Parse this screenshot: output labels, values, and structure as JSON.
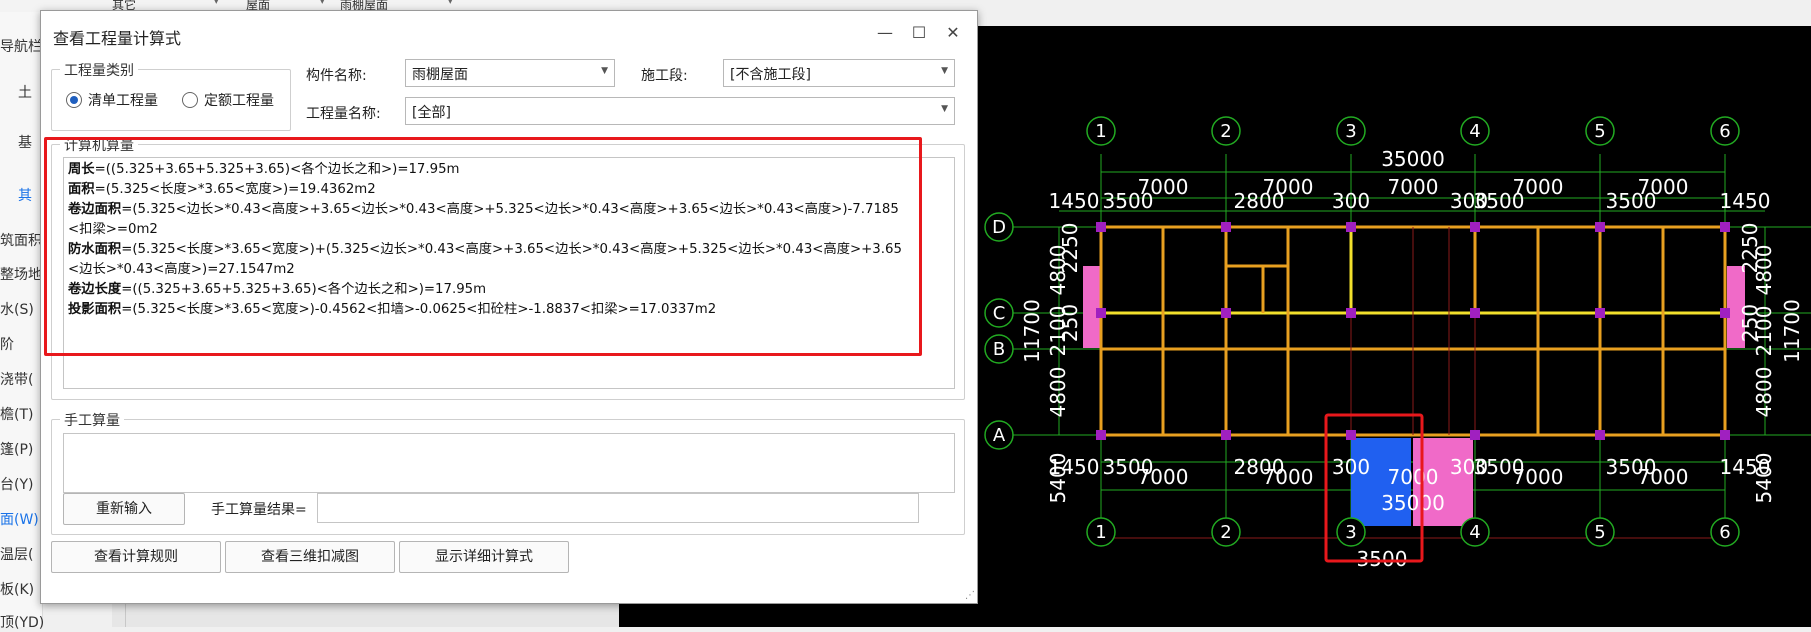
{
  "background": {
    "topbar": [
      "其它",
      "屋面",
      "雨棚屋面"
    ],
    "nav_items": [
      {
        "label": "导航栏",
        "active": false
      },
      {
        "label": "土",
        "active": false
      },
      {
        "label": "基",
        "active": false
      },
      {
        "label": "其",
        "active": true
      },
      {
        "label": "筑面积",
        "active": false
      },
      {
        "label": "整场地",
        "active": false
      },
      {
        "label": "水(S)",
        "active": false
      },
      {
        "label": "阶",
        "active": false
      },
      {
        "label": "浇带(",
        "active": false
      },
      {
        "label": "檐(T)",
        "active": false
      },
      {
        "label": "篷(P)",
        "active": false
      },
      {
        "label": "台(Y)",
        "active": false
      },
      {
        "label": "面(W)",
        "active": true
      },
      {
        "label": "温层(",
        "active": false
      },
      {
        "label": "板(K)",
        "active": false
      },
      {
        "label": "顶(YD)",
        "active": false
      }
    ]
  },
  "dialog": {
    "title": "查看工程量计算式",
    "quantity_type": {
      "group_label": "工程量类别",
      "options": [
        "清单工程量",
        "定额工程量"
      ],
      "selected": "清单工程量"
    },
    "component_name_label": "构件名称:",
    "component_name_value": "雨棚屋面",
    "stage_label": "施工段:",
    "stage_value": "[不含施工段]",
    "quantity_name_label": "工程量名称:",
    "quantity_name_value": "[全部]",
    "computer_calc": {
      "group_label": "计算机算量",
      "lines": [
        {
          "bold": "周长",
          "rest": "=((5.325+3.65+5.325+3.65)<各个边长之和>)=17.95m"
        },
        {
          "bold": "面积",
          "rest": "=(5.325<长度>*3.65<宽度>)=19.4362m2"
        },
        {
          "bold": "卷边面积",
          "rest": "=(5.325<边长>*0.43<高度>+3.65<边长>*0.43<高度>+5.325<边长>*0.43<高度>+3.65<边长>*0.43<高度>)-7.7185"
        },
        {
          "bold": "",
          "rest": "<扣梁>=0m2"
        },
        {
          "bold": "防水面积",
          "rest": "=(5.325<长度>*3.65<宽度>)+(5.325<边长>*0.43<高度>+3.65<边长>*0.43<高度>+5.325<边长>*0.43<高度>+3.65"
        },
        {
          "bold": "",
          "rest": "<边长>*0.43<高度>)=27.1547m2"
        },
        {
          "bold": "卷边长度",
          "rest": "=((5.325+3.65+5.325+3.65)<各个边长之和>)=17.95m"
        },
        {
          "bold": "投影面积",
          "rest": "=(5.325<长度>*3.65<宽度>)-0.4562<扣墙>-0.0625<扣砼柱>-1.8837<扣梁>=17.0337m2"
        }
      ]
    },
    "manual_calc": {
      "group_label": "手工算量",
      "reenter_button": "重新输入",
      "result_label": "手工算量结果="
    },
    "footer_buttons": [
      "查看计算规则",
      "查看三维扣减图",
      "显示详细计算式"
    ]
  },
  "cad": {
    "axis_numbers": [
      "1",
      "2",
      "3",
      "4",
      "5",
      "6"
    ],
    "axis_letters": [
      "D",
      "C",
      "B",
      "A"
    ],
    "total_dim_top": "35000",
    "total_dim_bottom": "35000",
    "top_spans": [
      "7000",
      "7000",
      "7000",
      "7000",
      "7000"
    ],
    "top_sub_dims": [
      "1450",
      "3500",
      "2800",
      "300",
      "300",
      "3500",
      "3500",
      "1450"
    ],
    "bottom_sub_dims": [
      "1450",
      "3500",
      "2800",
      "300",
      "300",
      "3500",
      "3500",
      "1450"
    ],
    "bottom_spans": [
      "7000",
      "7000",
      "7000",
      "7000",
      "7000"
    ],
    "bottom_third": "3500",
    "left_dims": [
      "11700",
      "4800",
      "2100",
      "4800",
      "250",
      "2250",
      "5400"
    ],
    "right_dims": [
      "11700",
      "4800",
      "2100",
      "4800",
      "250",
      "2250",
      "5400"
    ],
    "colors": {
      "grid": "#22aa22",
      "beam": "#e8a020",
      "column": "#a020c0",
      "canopy_pink": "#f06ac8",
      "selected_blue": "#2060f0",
      "highlight": "#e8181c"
    }
  }
}
